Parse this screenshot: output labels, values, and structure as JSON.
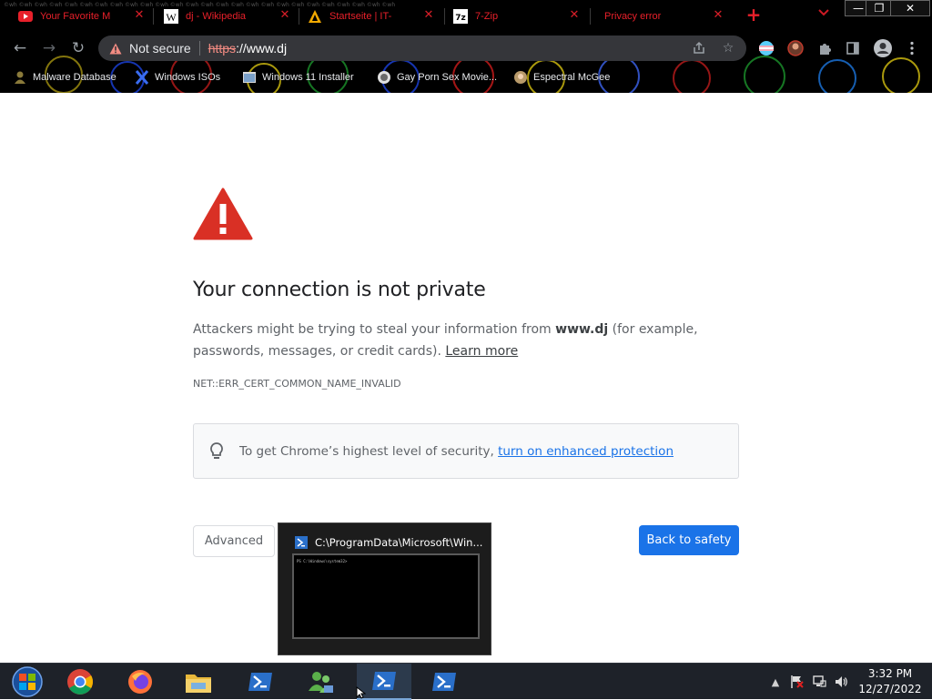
{
  "browser": {
    "tabs": [
      {
        "title": "Your Favorite M",
        "favicon": "youtube-icon"
      },
      {
        "title": "dj - Wikipedia",
        "favicon": "wikipedia-icon"
      },
      {
        "title": "Startseite | IT-",
        "favicon": "warning-triangle-icon"
      },
      {
        "title": "7-Zip",
        "favicon": "7zip-icon"
      },
      {
        "title": "Privacy error",
        "favicon": "none"
      }
    ],
    "tab_close_glyph": "✕",
    "new_tab_glyph": "+",
    "window_controls": {
      "minimize": "—",
      "restore": "❐",
      "close": "✕"
    },
    "omnibox": {
      "security_label": "Not secure",
      "url_scheme": "https",
      "url_rest": "://www.dj"
    },
    "bookmarks": [
      {
        "label": "Malware Database",
        "icon": "malware-icon"
      },
      {
        "label": "Windows ISOs",
        "icon": "x-icon"
      },
      {
        "label": "Windows 11 Installer",
        "icon": "installer-icon"
      },
      {
        "label": "Gay Porn Sex Movie...",
        "icon": "site-icon"
      },
      {
        "label": "Espectral McGee",
        "icon": "site-icon"
      }
    ],
    "accent_color": "#e8202a"
  },
  "interstitial": {
    "heading": "Your connection is not private",
    "message_prefix": "Attackers might be trying to steal your information from ",
    "message_host": "www.dj",
    "message_suffix": " (for example, passwords, messages, or credit cards). ",
    "learn_more": "Learn more",
    "error_code": "NET::ERR_CERT_COMMON_NAME_INVALID",
    "enhanced_prefix": "To get Chrome’s highest level of security, ",
    "enhanced_link": "turn on enhanced protection",
    "advanced_label": "Advanced",
    "back_label": "Back to safety",
    "primary_color": "#1a73e8",
    "warning_color": "#d93025"
  },
  "thumbnail_preview": {
    "window_title": "C:\\ProgramData\\Microsoft\\Win...",
    "console_line": "PS C:\\Windows\\system32>"
  },
  "taskbar": {
    "items": [
      "start-orb-icon",
      "chrome-icon",
      "firefox-icon",
      "file-explorer-icon",
      "powershell-icon",
      "users-icon",
      "powershell-icon",
      "powershell-icon"
    ],
    "clock_time": "3:32 PM",
    "clock_date": "12/27/2022"
  }
}
